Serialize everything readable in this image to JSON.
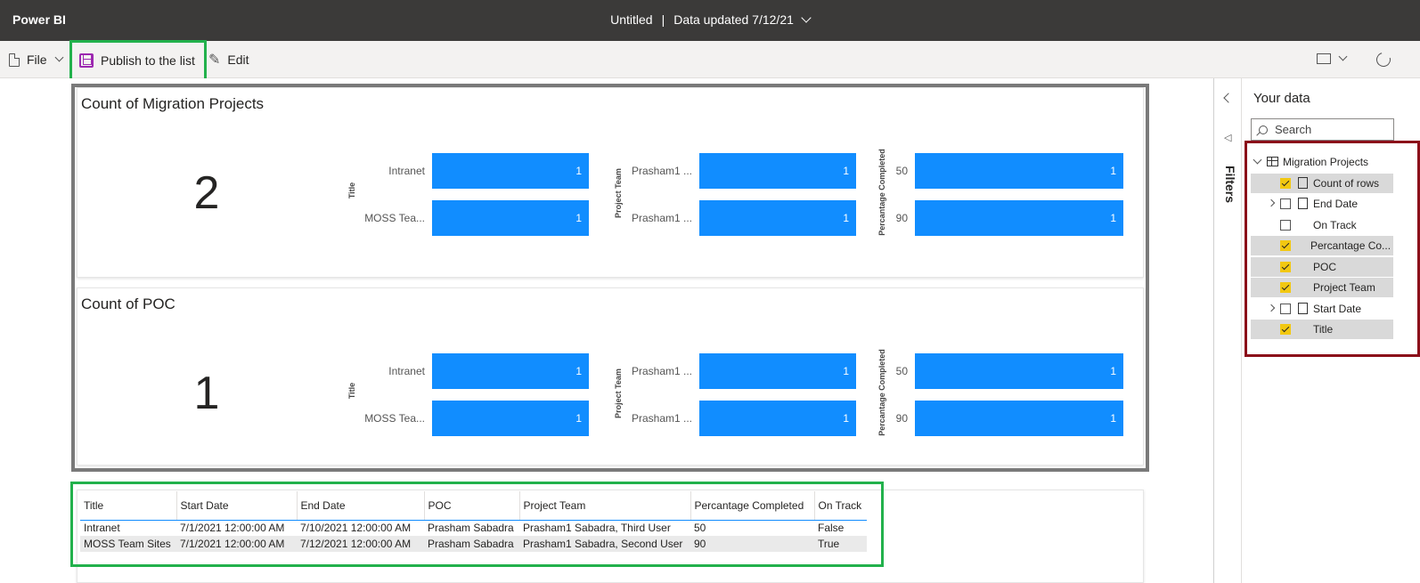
{
  "app": {
    "name": "Power BI",
    "doc_title": "Untitled",
    "separator": "|",
    "data_updated": "Data updated 7/12/21"
  },
  "toolbar": {
    "file_label": "File",
    "publish_label": "Publish to the list",
    "edit_label": "Edit"
  },
  "cards": [
    {
      "title": "Count of Migration Projects",
      "big_number": "2",
      "charts": [
        {
          "axis": "Title",
          "categories": [
            "Intranet",
            "MOSS Tea..."
          ],
          "values": [
            "1",
            "1"
          ]
        },
        {
          "axis": "Project Team",
          "categories": [
            "Prasham1 ...",
            "Prasham1 ..."
          ],
          "values": [
            "1",
            "1"
          ]
        },
        {
          "axis": "Percantage Completed",
          "categories": [
            "50",
            "90"
          ],
          "values": [
            "1",
            "1"
          ]
        }
      ]
    },
    {
      "title": "Count of POC",
      "big_number": "1",
      "charts": [
        {
          "axis": "Title",
          "categories": [
            "Intranet",
            "MOSS Tea..."
          ],
          "values": [
            "1",
            "1"
          ]
        },
        {
          "axis": "Project Team",
          "categories": [
            "Prasham1 ...",
            "Prasham1 ..."
          ],
          "values": [
            "1",
            "1"
          ]
        },
        {
          "axis": "Percantage Completed",
          "categories": [
            "50",
            "90"
          ],
          "values": [
            "1",
            "1"
          ]
        }
      ]
    }
  ],
  "table": {
    "headers": [
      "Title",
      "Start Date",
      "End Date",
      "POC",
      "Project Team",
      "Percantage Completed",
      "On Track"
    ],
    "rows": [
      [
        "Intranet",
        "7/1/2021 12:00:00 AM",
        "7/10/2021 12:00:00 AM",
        "Prasham Sabadra",
        "Prasham1 Sabadra, Third User",
        "50",
        "False"
      ],
      [
        "MOSS Team Sites",
        "7/1/2021 12:00:00 AM",
        "7/12/2021 12:00:00 AM",
        "Prasham Sabadra",
        "Prasham1 Sabadra, Second User",
        "90",
        "True"
      ]
    ]
  },
  "filters_pane": {
    "label": "Filters"
  },
  "data_pane": {
    "title": "Your data",
    "search_placeholder": "Search",
    "table_name": "Migration Projects",
    "fields": [
      {
        "label": "Count of rows",
        "checked": true,
        "icon": "calculator-icon",
        "expandable": false
      },
      {
        "label": "End Date",
        "checked": false,
        "icon": "calendar-icon",
        "expandable": true
      },
      {
        "label": "On Track",
        "checked": false,
        "icon": "",
        "expandable": false
      },
      {
        "label": "Percantage Co...",
        "checked": true,
        "icon": "",
        "expandable": false
      },
      {
        "label": "POC",
        "checked": true,
        "icon": "",
        "expandable": false
      },
      {
        "label": "Project Team",
        "checked": true,
        "icon": "",
        "expandable": false
      },
      {
        "label": "Start Date",
        "checked": false,
        "icon": "calendar-icon",
        "expandable": true
      },
      {
        "label": "Title",
        "checked": true,
        "icon": "",
        "expandable": false
      }
    ]
  },
  "colors": {
    "bar": "#118dff",
    "highlight_green": "#22b14c",
    "highlight_red": "#8b0c19",
    "check_yellow": "#f2c811"
  }
}
